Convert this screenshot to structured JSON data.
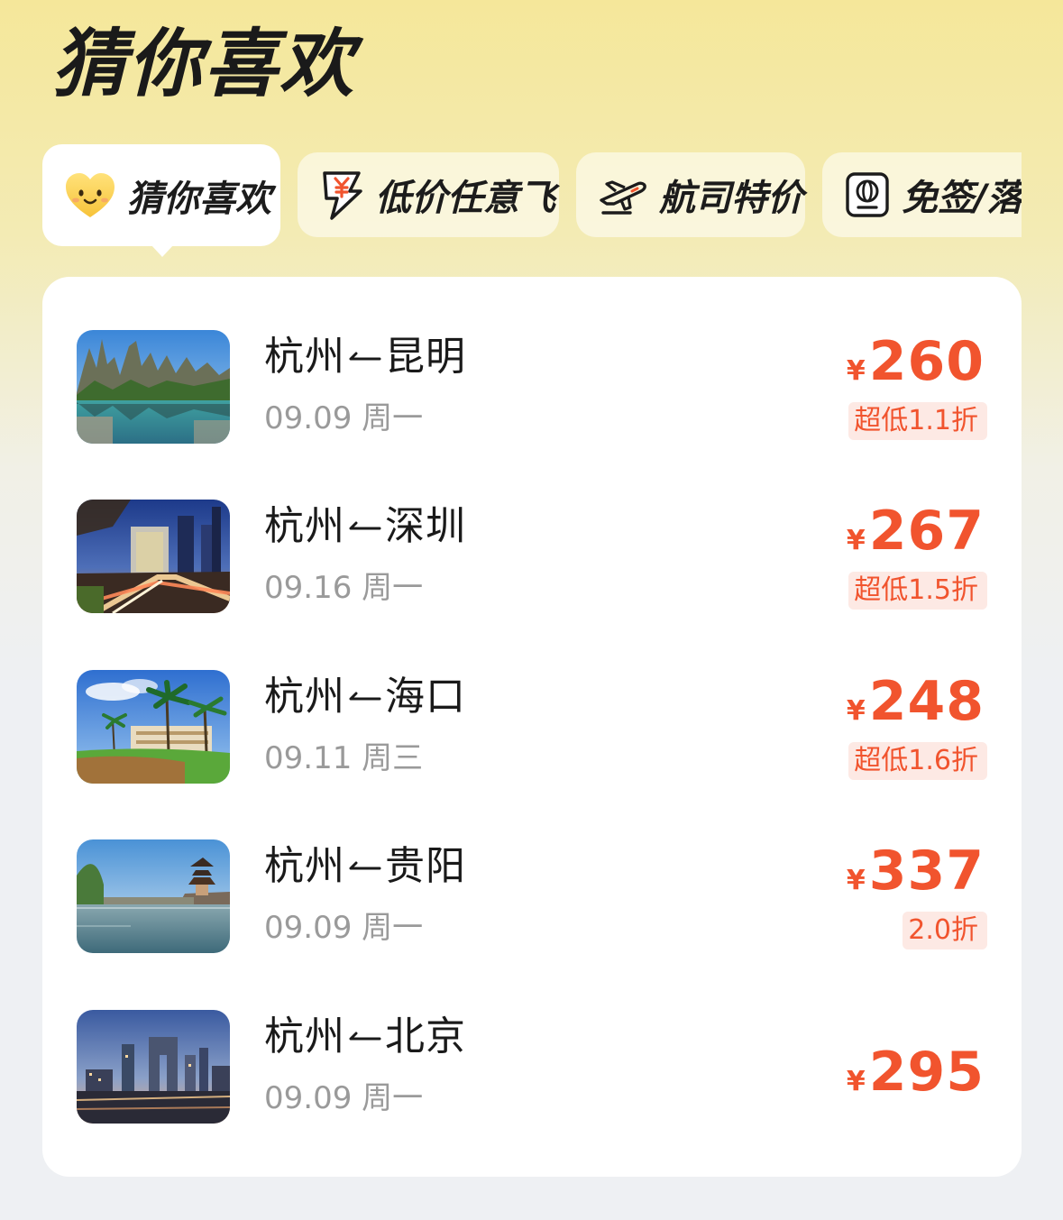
{
  "header": {
    "title": "猜你喜欢"
  },
  "tabs": [
    {
      "label": "猜你喜欢",
      "icon": "heart-smile-icon",
      "active": true
    },
    {
      "label": "低价任意飞",
      "icon": "yen-lightning-icon",
      "active": false
    },
    {
      "label": "航司特价",
      "icon": "airplane-icon",
      "active": false
    },
    {
      "label": "免签/落地",
      "icon": "passport-icon",
      "active": false
    }
  ],
  "flights": [
    {
      "route": "杭州 → 昆明",
      "from": "杭州",
      "to": "昆明",
      "date": "09.09 周一",
      "currency": "¥",
      "price": "260",
      "discount": "超低1.1折",
      "image": "stone-forest-lake-image"
    },
    {
      "route": "杭州 → 深圳",
      "from": "杭州",
      "to": "深圳",
      "date": "09.16 周一",
      "currency": "¥",
      "price": "267",
      "discount": "超低1.5折",
      "image": "city-night-traffic-image"
    },
    {
      "route": "杭州 → 海口",
      "from": "杭州",
      "to": "海口",
      "date": "09.11 周三",
      "currency": "¥",
      "price": "248",
      "discount": "超低1.6折",
      "image": "palm-trees-building-image"
    },
    {
      "route": "杭州 → 贵阳",
      "from": "杭州",
      "to": "贵阳",
      "date": "09.09 周一",
      "currency": "¥",
      "price": "337",
      "discount": "2.0折",
      "image": "river-pavilion-image"
    },
    {
      "route": "杭州 → 北京",
      "from": "杭州",
      "to": "北京",
      "date": "09.09 周一",
      "currency": "¥",
      "price": "295",
      "discount": "",
      "image": "beijing-skyline-image"
    }
  ],
  "colors": {
    "accent": "#f1542e",
    "discount_bg": "#fde9e4",
    "header_bg": "#f5e79a"
  }
}
